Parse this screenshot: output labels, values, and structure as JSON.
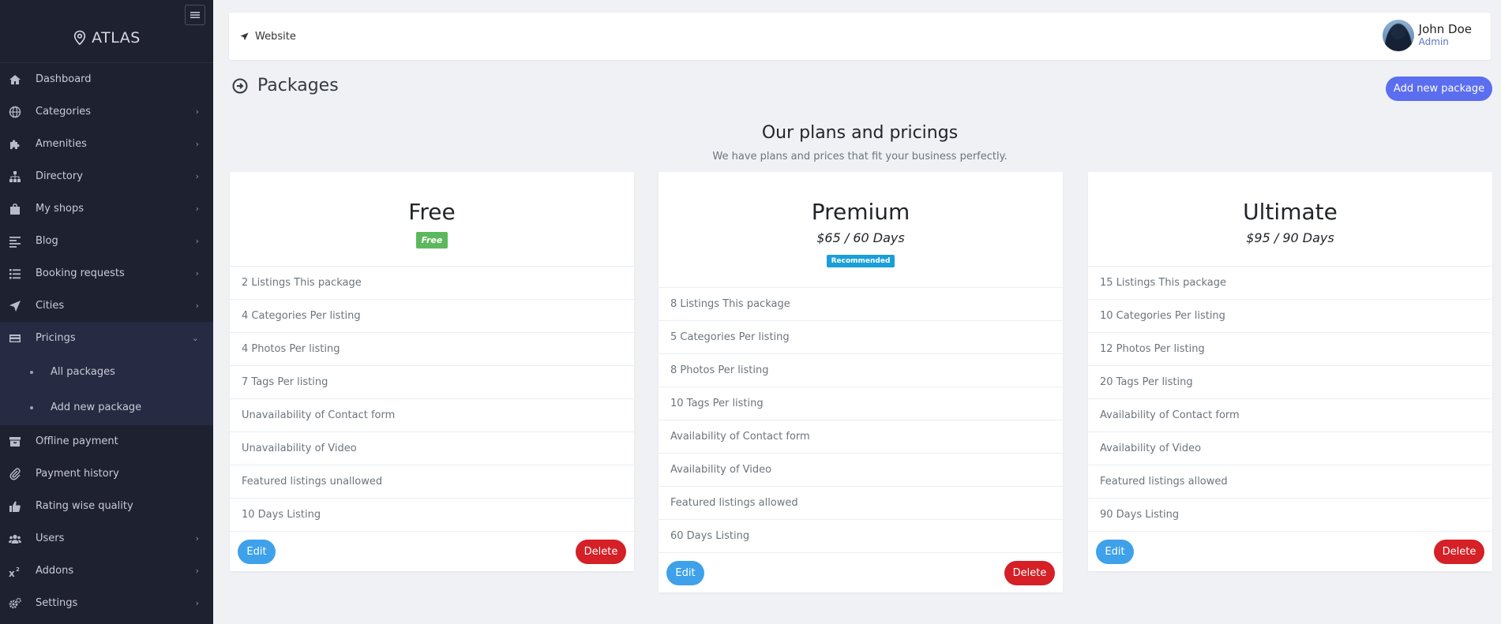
{
  "sidebar": {
    "brand": "ATLAS",
    "items": [
      {
        "label": "Dashboard",
        "icon": "home-icon"
      },
      {
        "label": "Categories",
        "icon": "globe-icon"
      },
      {
        "label": "Amenities",
        "icon": "puzzle-icon"
      },
      {
        "label": "Directory",
        "icon": "sitemap-icon"
      },
      {
        "label": "My shops",
        "icon": "shopping-bag-icon"
      },
      {
        "label": "Blog",
        "icon": "align-left-icon"
      },
      {
        "label": "Booking requests",
        "icon": "list-icon"
      },
      {
        "label": "Cities",
        "icon": "location-arrow-icon"
      },
      {
        "label": "Pricings",
        "icon": "credit-card-icon"
      },
      {
        "label": "Offline payment",
        "icon": "archive-icon"
      },
      {
        "label": "Payment history",
        "icon": "paperclip-icon"
      },
      {
        "label": "Rating wise quality",
        "icon": "thumbs-up-icon"
      },
      {
        "label": "Users",
        "icon": "users-icon"
      },
      {
        "label": "Addons",
        "icon": "superscript-icon"
      },
      {
        "label": "Settings",
        "icon": "cogs-icon"
      }
    ],
    "pricings_sub": [
      {
        "label": "All packages"
      },
      {
        "label": "Add new package"
      }
    ]
  },
  "header": {
    "website_label": "Website",
    "user_name": "John Doe",
    "user_role": "Admin"
  },
  "page": {
    "title": "Packages",
    "add_button": "Add new package",
    "section_title": "Our plans and pricings",
    "section_subtitle": "We have plans and prices that fit your business perfectly."
  },
  "packages": [
    {
      "name": "Free",
      "badge": "Free",
      "features": [
        "2 Listings This package",
        "4 Categories Per listing",
        "4 Photos Per listing",
        "7 Tags Per listing",
        "Unavailability of Contact form",
        "Unavailability of Video",
        "Featured listings unallowed",
        "10 Days Listing"
      ],
      "edit_label": "Edit",
      "delete_label": "Delete"
    },
    {
      "name": "Premium",
      "price": "$65 / 60 Days",
      "badge": "Recommended",
      "features": [
        "8 Listings This package",
        "5 Categories Per listing",
        "8 Photos Per listing",
        "10 Tags Per listing",
        "Availability of Contact form",
        "Availability of Video",
        "Featured listings allowed",
        "60 Days Listing"
      ],
      "edit_label": "Edit",
      "delete_label": "Delete"
    },
    {
      "name": "Ultimate",
      "price": "$95 / 90 Days",
      "features": [
        "15 Listings This package",
        "10 Categories Per listing",
        "12 Photos Per listing",
        "20 Tags Per listing",
        "Availability of Contact form",
        "Availability of Video",
        "Featured listings allowed",
        "90 Days Listing"
      ],
      "edit_label": "Edit",
      "delete_label": "Delete"
    }
  ],
  "colors": {
    "sidebar_bg": "#1e2130",
    "accent": "#5b6ef0",
    "edit": "#3ea1ea",
    "delete": "#d42026",
    "free_badge": "#5cb85c",
    "recommended_badge": "#1a9fd8"
  }
}
